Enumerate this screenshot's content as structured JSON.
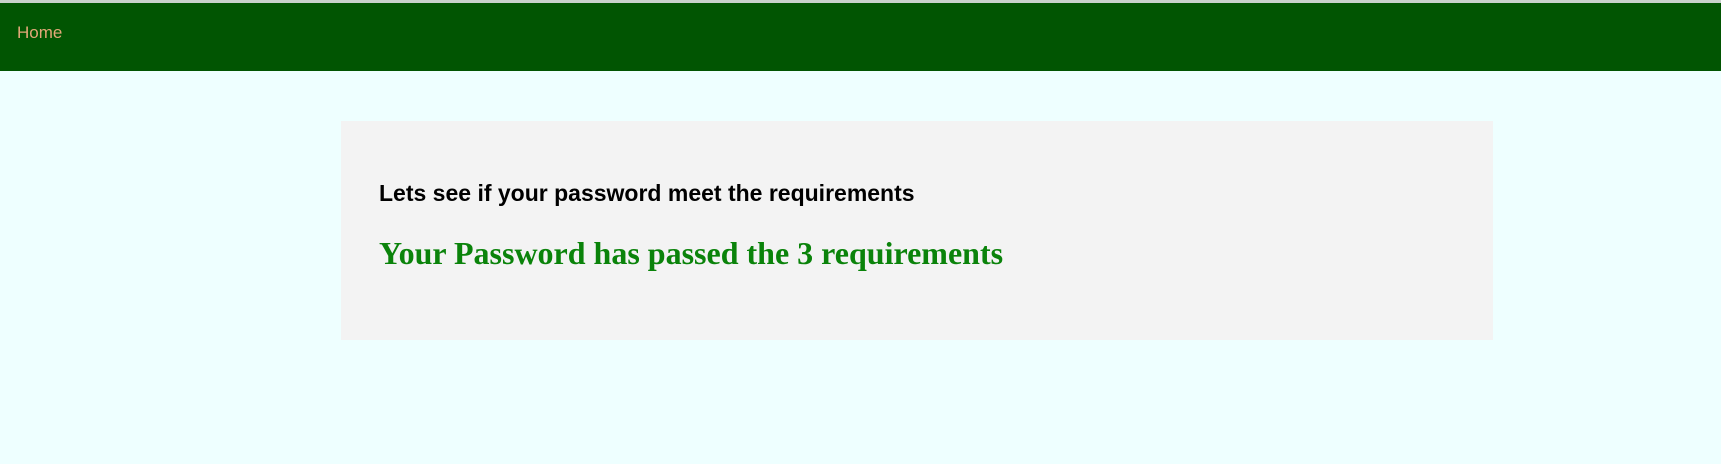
{
  "colors": {
    "page_background": "#eeffff",
    "navbar_background": "#015502",
    "nav_link": "#e3a878",
    "card_background": "#f3f3f3",
    "success_text": "#0a830a"
  },
  "navbar": {
    "home_label": "Home"
  },
  "card": {
    "heading": "Lets see if your password meet the requirements",
    "result": "Your Password has passed the 3 requirements"
  }
}
